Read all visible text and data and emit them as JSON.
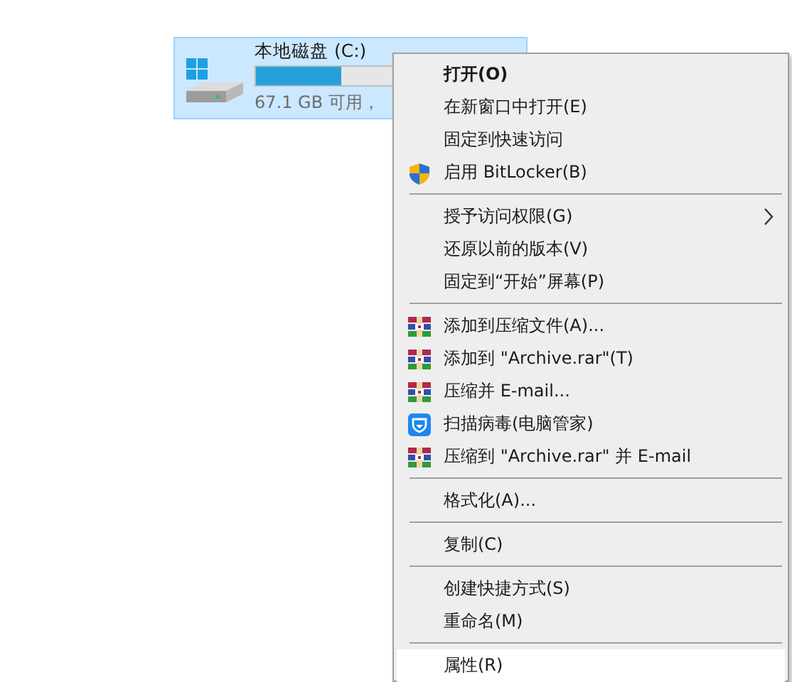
{
  "drives": [
    {
      "name": "本地磁盘 (C:)",
      "free": "67.1 GB 可用，",
      "level": 0.32,
      "selected": true
    }
  ],
  "context_menu": {
    "items": [
      {
        "kind": "item",
        "label": "打开(O)",
        "default": true,
        "selected": false
      },
      {
        "kind": "item",
        "label": "在新窗口中打开(E)",
        "selected": false
      },
      {
        "kind": "item",
        "label": "固定到快速访问",
        "selected": false
      },
      {
        "kind": "shield",
        "label": "启用 BitLocker(B)",
        "selected": false
      },
      {
        "kind": "separator"
      },
      {
        "kind": "item",
        "label": "授予访问权限(G)",
        "submenu": true,
        "selected": false
      },
      {
        "kind": "item",
        "label": "还原以前的版本(V)",
        "selected": false
      },
      {
        "kind": "item",
        "label": "固定到“开始”屏幕(P)",
        "selected": false
      },
      {
        "kind": "separator"
      },
      {
        "kind": "archive",
        "label": "添加到压缩文件(A)...",
        "selected": false
      },
      {
        "kind": "archive",
        "label": "添加到 \"Archive.rar\"(T)",
        "selected": false
      },
      {
        "kind": "archive",
        "label": "压缩并 E-mail...",
        "selected": false
      },
      {
        "kind": "antivirus",
        "label": "扫描病毒(电脑管家)",
        "selected": false
      },
      {
        "kind": "archive",
        "label": "压缩到 \"Archive.rar\" 并 E-mail",
        "selected": false
      },
      {
        "kind": "separator"
      },
      {
        "kind": "item",
        "label": "格式化(A)...",
        "selected": false
      },
      {
        "kind": "separator"
      },
      {
        "kind": "item",
        "label": "复制(C)",
        "selected": false
      },
      {
        "kind": "separator"
      },
      {
        "kind": "item",
        "label": "创建快捷方式(S)",
        "selected": false
      },
      {
        "kind": "item",
        "label": "重命名(M)",
        "selected": false
      },
      {
        "kind": "separator"
      },
      {
        "kind": "item",
        "label": "属性(R)",
        "selected": true
      }
    ]
  }
}
